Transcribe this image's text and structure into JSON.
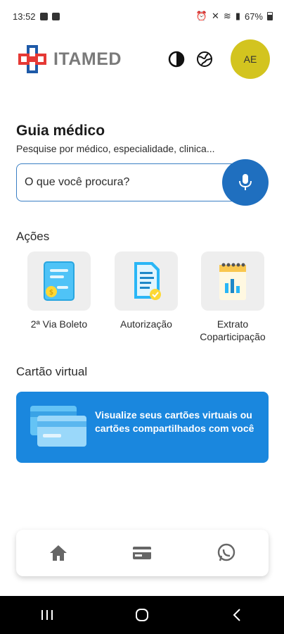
{
  "status_bar": {
    "time": "13:52",
    "battery": "67%"
  },
  "header": {
    "brand": "ITAMED",
    "avatar_initials": "AE"
  },
  "guide": {
    "title": "Guia médico",
    "subtitle": "Pesquise por médico, especialidade, clinica...",
    "search_placeholder": "O que você procura?"
  },
  "actions": {
    "title": "Ações",
    "items": [
      {
        "label": "2ª Via Boleto"
      },
      {
        "label": "Autorização"
      },
      {
        "label": "Extrato Coparticipação"
      }
    ]
  },
  "virtual_card": {
    "title": "Cartão virtual",
    "banner_text": "Visualize seus cartões virtuais ou cartões compartilhados com você"
  },
  "bottom_nav": {
    "items": [
      "home-icon",
      "card-icon",
      "whatsapp-icon"
    ]
  },
  "colors": {
    "primary": "#1f6fbf",
    "banner": "#1a87de",
    "avatar": "#d3c41f",
    "logo_red": "#e53935",
    "logo_blue": "#1e5aa8"
  }
}
